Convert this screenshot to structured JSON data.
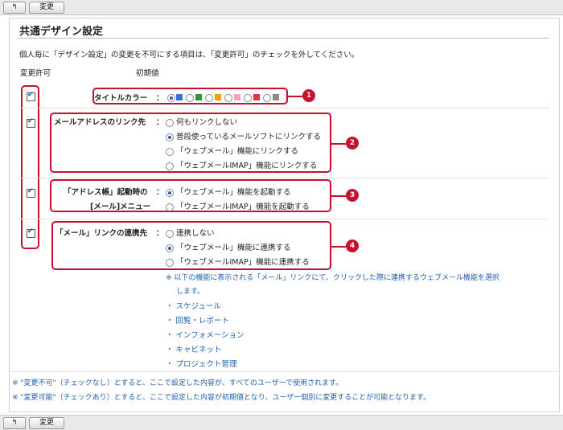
{
  "toolbar": {
    "back_icon": "back-arrow-icon",
    "change_label": "変更"
  },
  "page": {
    "title": "共通デザイン設定",
    "description": "個人毎に「デザイン設定」の変更を不可にする項目は、「変更許可」のチェックを外してください。",
    "col_permission": "変更許可",
    "col_default": "初期値"
  },
  "rows": {
    "title_color": {
      "label": "タイトルカラー",
      "colon": "：",
      "badge": "1",
      "colors": [
        "#3a6fd8",
        "#2e9a2e",
        "#f2a20c",
        "#f3a3bd",
        "#e0323c",
        "#8a8a8a"
      ],
      "selected_index": 0
    },
    "mail_link": {
      "label": "メールアドレスのリンク先",
      "colon": "：",
      "badge": "2",
      "options": [
        "何もリンクしない",
        "普段使っているメールソフトにリンクする",
        "「ウェブメール」機能にリンクする",
        "「ウェブメールIMAP」機能にリンクする"
      ],
      "selected_index": 1
    },
    "address_book": {
      "label1": "「アドレス帳」起動時の",
      "label2": "[メール]メニュー",
      "colon": "：",
      "badge": "3",
      "options": [
        "「ウェブメール」機能を起動する",
        "「ウェブメールIMAP」機能を起動する"
      ],
      "selected_index": 0
    },
    "mail_link_cooperation": {
      "label": "「メール」リンクの連携先",
      "colon": "：",
      "badge": "4",
      "options": [
        "連携しない",
        "「ウェブメール」機能に連携する",
        "「ウェブメールIMAP」機能に連携する"
      ],
      "selected_index": 1,
      "note_line1": "※ 以下の機能に表示される「メール」リンクにて、クリックした際に連携するウェブメール機能を選択",
      "note_line2": "します。",
      "features": [
        "・ スケジュール",
        "・ 回覧・レポート",
        "・ インフォメーション",
        "・ キャビネット",
        "・ プロジェクト管理"
      ]
    }
  },
  "footnotes": [
    "※ \"変更不可\"（チェックなし）とすると、ここで設定した内容が、すべてのユーザーで使用されます。",
    "※ \"変更可能\"（チェックあり）とすると、ここで設定した内容が初期値となり、ユーザー個別に変更することが可能となります。"
  ]
}
